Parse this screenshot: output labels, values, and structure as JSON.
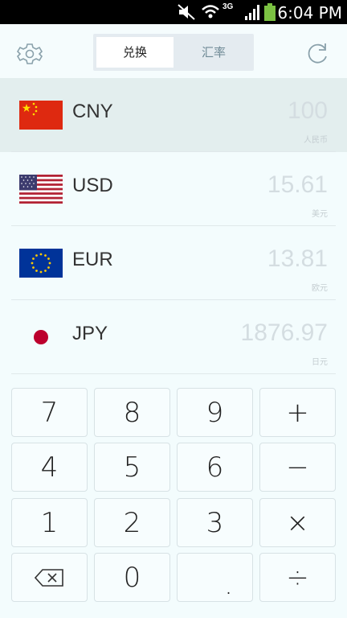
{
  "status_bar": {
    "time": "6:04 PM",
    "network": "3G",
    "icons": [
      "mute-icon",
      "wifi-icon",
      "signal-icon",
      "battery-icon"
    ]
  },
  "header": {
    "settings_icon": "gear-icon",
    "refresh_icon": "refresh-icon",
    "tabs": [
      {
        "label": "兑换",
        "active": true
      },
      {
        "label": "汇率",
        "active": false
      }
    ]
  },
  "currencies": [
    {
      "code": "CNY",
      "amount": "100",
      "name": "人民币",
      "selected": true
    },
    {
      "code": "USD",
      "amount": "15.61",
      "name": "美元",
      "selected": false
    },
    {
      "code": "EUR",
      "amount": "13.81",
      "name": "欧元",
      "selected": false
    },
    {
      "code": "JPY",
      "amount": "1876.97",
      "name": "日元",
      "selected": false
    }
  ],
  "keypad": {
    "row1": [
      "7",
      "8",
      "9",
      "+"
    ],
    "row2": [
      "4",
      "5",
      "6",
      "−"
    ],
    "row3": [
      "1",
      "2",
      "3",
      "×"
    ],
    "row4": [
      "backspace-icon",
      "0",
      ".",
      "÷"
    ]
  },
  "colors": {
    "background": "#f3fcfd",
    "selected_row": "#e3eeee",
    "amount_text": "#d4dde1"
  }
}
